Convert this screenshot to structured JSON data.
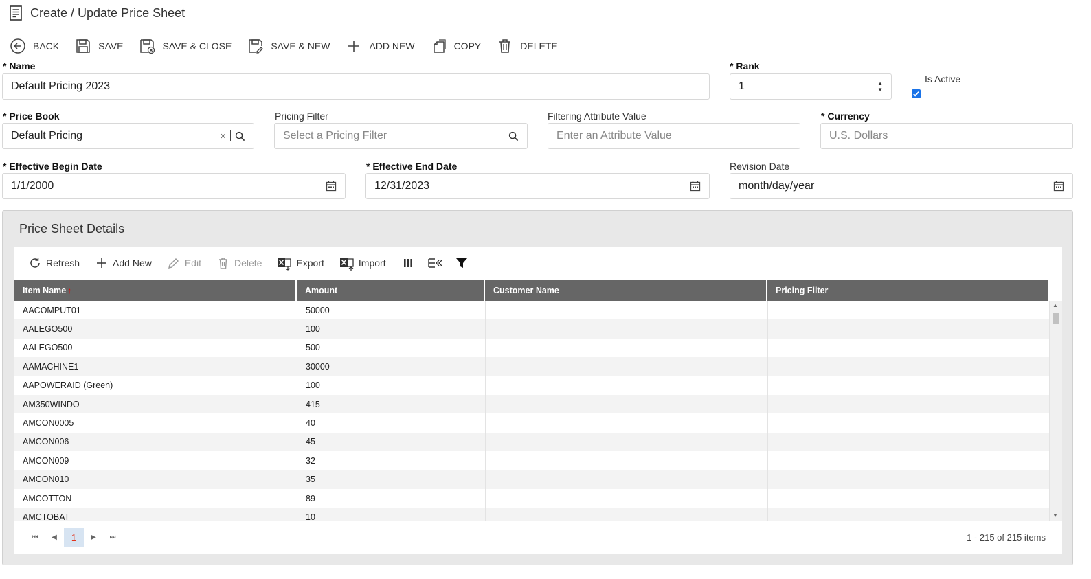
{
  "page_title": "Create / Update Price Sheet",
  "toolbar": {
    "back": "BACK",
    "save": "SAVE",
    "save_close": "SAVE & CLOSE",
    "save_new": "SAVE & NEW",
    "add_new": "ADD NEW",
    "copy": "COPY",
    "delete": "DELETE"
  },
  "form": {
    "name_label": "* Name",
    "name_value": "Default Pricing 2023",
    "rank_label": "* Rank",
    "rank_value": "1",
    "is_active_label": "Is Active",
    "is_active_checked": true,
    "price_book_label": "* Price Book",
    "price_book_value": "Default Pricing",
    "pricing_filter_label": "Pricing Filter",
    "pricing_filter_placeholder": "Select a Pricing Filter",
    "filter_attr_label": "Filtering Attribute Value",
    "filter_attr_placeholder": "Enter an Attribute Value",
    "currency_label": "* Currency",
    "currency_value": "U.S. Dollars",
    "begin_date_label": "* Effective Begin Date",
    "begin_date_value": "1/1/2000",
    "end_date_label": "* Effective End Date",
    "end_date_value": "12/31/2023",
    "revision_date_label": "Revision Date",
    "revision_date_value": "month/day/year"
  },
  "details": {
    "title": "Price Sheet Details",
    "toolbar": {
      "refresh": "Refresh",
      "add_new": "Add New",
      "edit": "Edit",
      "delete": "Delete",
      "export": "Export",
      "import": "Import"
    },
    "columns": [
      "Item Name",
      "Amount",
      "Customer Name",
      "Pricing Filter"
    ],
    "sort_indicator": "↑",
    "rows": [
      [
        "AACOMPUT01",
        "50000",
        "",
        ""
      ],
      [
        "AALEGO500",
        "100",
        "",
        ""
      ],
      [
        "AALEGO500",
        "500",
        "",
        ""
      ],
      [
        "AAMACHINE1",
        "30000",
        "",
        ""
      ],
      [
        "AAPOWERAID (Green)",
        "100",
        "",
        ""
      ],
      [
        "AM350WINDO",
        "415",
        "",
        ""
      ],
      [
        "AMCON0005",
        "40",
        "",
        ""
      ],
      [
        "AMCON006",
        "45",
        "",
        ""
      ],
      [
        "AMCON009",
        "32",
        "",
        ""
      ],
      [
        "AMCON010",
        "35",
        "",
        ""
      ],
      [
        "AMCOTTON",
        "89",
        "",
        ""
      ],
      [
        "AMCTOBAT",
        "10",
        "",
        ""
      ]
    ],
    "pager": {
      "current_page": "1",
      "info": "1 - 215 of 215 items"
    }
  },
  "colors": {
    "header_bg": "#666666",
    "accent": "#1a73e8",
    "sort_arrow": "#e00000",
    "panel_bg": "#e8e8e8"
  }
}
